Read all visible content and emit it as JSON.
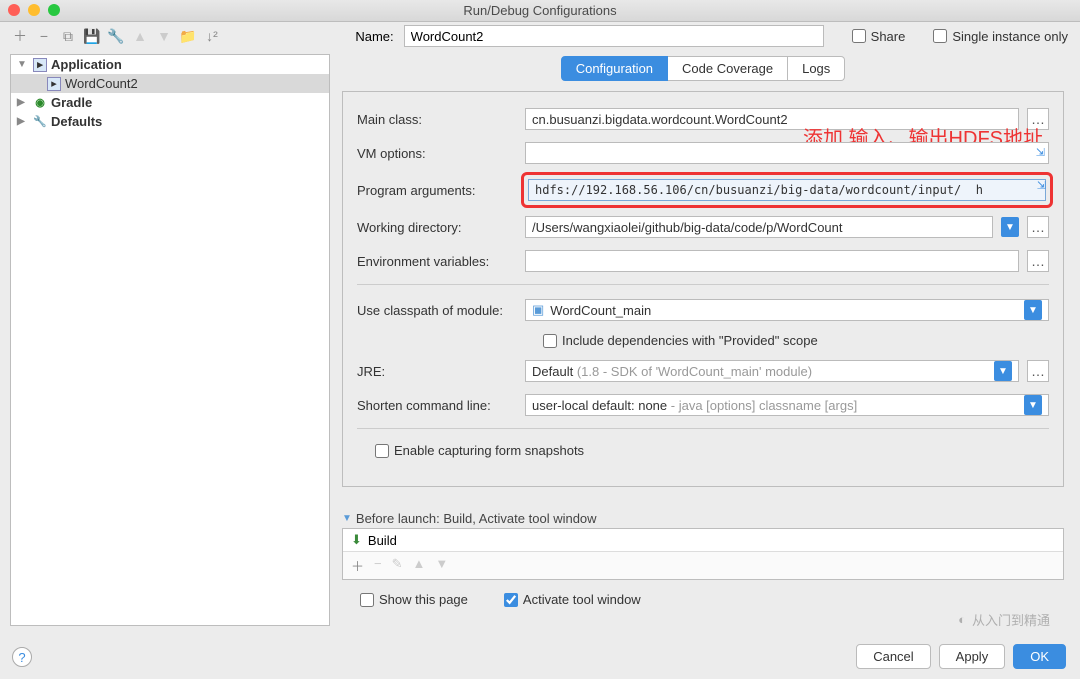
{
  "window": {
    "title": "Run/Debug Configurations"
  },
  "toolbar": {
    "name_label": "Name:",
    "name_value": "WordCount2",
    "share_label": "Share",
    "single_instance_label": "Single instance only"
  },
  "sidebar": {
    "items": [
      {
        "label": "Application",
        "icon": "app-icon",
        "expanded": true,
        "bold": true
      },
      {
        "label": "WordCount2",
        "icon": "app-icon",
        "selected": true,
        "indent": 1
      },
      {
        "label": "Gradle",
        "icon": "gradle-icon",
        "expanded": false,
        "bold": true
      },
      {
        "label": "Defaults",
        "icon": "defaults-icon",
        "expanded": false,
        "bold": true
      }
    ]
  },
  "tabs": [
    {
      "label": "Configuration",
      "active": true
    },
    {
      "label": "Code Coverage",
      "active": false
    },
    {
      "label": "Logs",
      "active": false
    }
  ],
  "config": {
    "main_class": {
      "label": "Main class:",
      "value": "cn.busuanzi.bigdata.wordcount.WordCount2"
    },
    "vm_options": {
      "label": "VM options:",
      "value": ""
    },
    "program_args": {
      "label": "Program arguments:",
      "value": "hdfs://192.168.56.106/cn/busuanzi/big-data/wordcount/input/  h"
    },
    "working_dir": {
      "label": "Working directory:",
      "value": "/Users/wangxiaolei/github/big-data/code/p/WordCount"
    },
    "env_vars": {
      "label": "Environment variables:",
      "value": ""
    },
    "classpath": {
      "label": "Use classpath of module:",
      "value": "WordCount_main"
    },
    "include_provided": {
      "label": "Include dependencies with \"Provided\" scope",
      "checked": false
    },
    "jre": {
      "label": "JRE:",
      "value": "Default",
      "hint": "(1.8 - SDK of 'WordCount_main' module)"
    },
    "shorten": {
      "label": "Shorten command line:",
      "value": "user-local default: none",
      "hint": "- java [options] classname [args]"
    },
    "enable_snapshots": {
      "label": "Enable capturing form snapshots",
      "checked": false
    }
  },
  "annotation": "添加 输入、输出HDFS地址",
  "before_launch": {
    "header": "Before launch: Build, Activate tool window",
    "items": [
      {
        "label": "Build"
      }
    ],
    "show_page": {
      "label": "Show this page",
      "checked": false
    },
    "activate_tool": {
      "label": "Activate tool window",
      "checked": true
    }
  },
  "footer": {
    "cancel": "Cancel",
    "apply": "Apply",
    "ok": "OK"
  },
  "watermark": "从入门到精通"
}
